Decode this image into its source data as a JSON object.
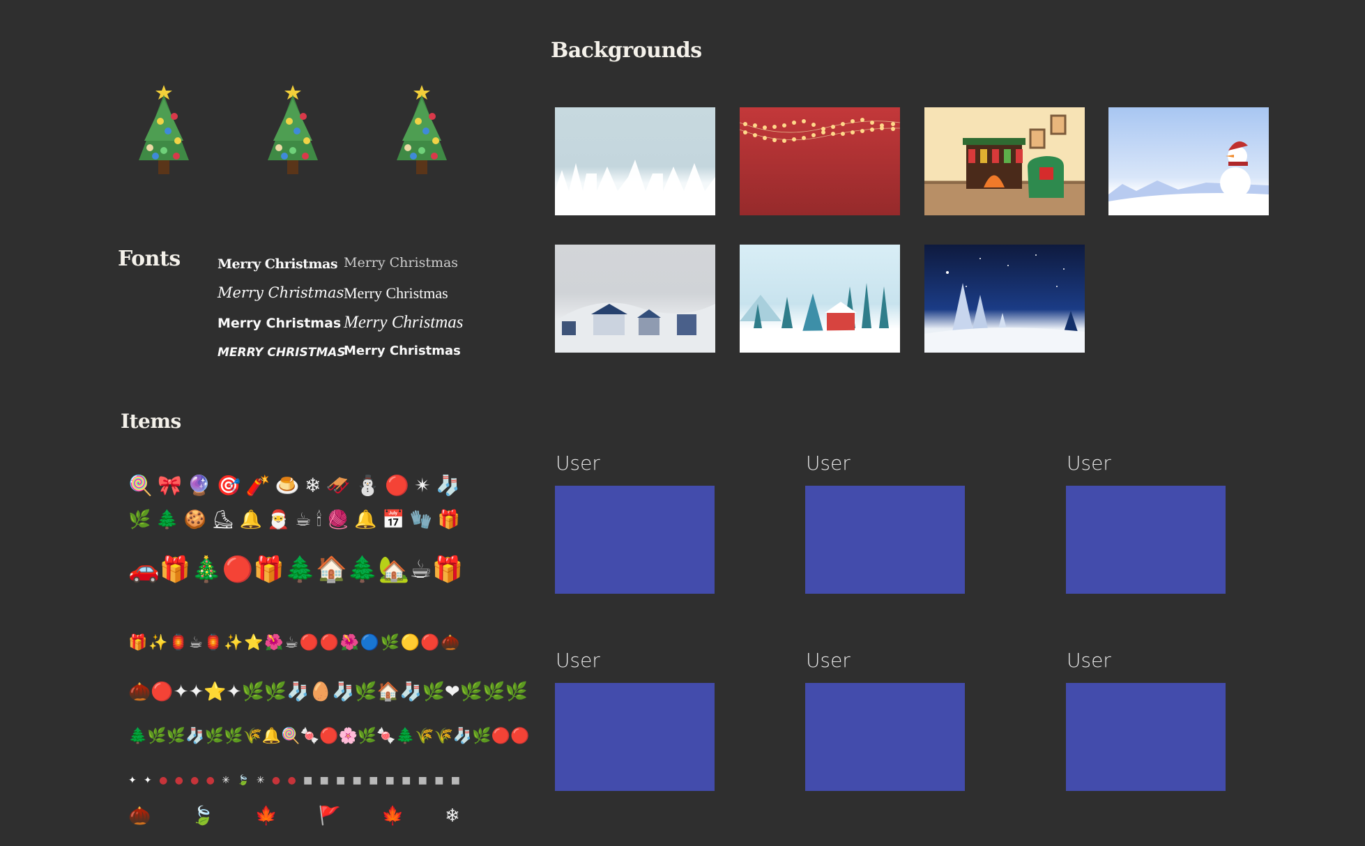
{
  "sections": {
    "backgrounds_title": "Backgrounds",
    "fonts_title": "Fonts",
    "items_title": "Items"
  },
  "trees": [
    {
      "icon": "christmas-tree-icon",
      "glyph": "🎄"
    },
    {
      "icon": "christmas-tree-icon",
      "glyph": "🎄"
    },
    {
      "icon": "christmas-tree-icon",
      "glyph": "🎄"
    }
  ],
  "fonts": {
    "samples": [
      "Merry Christmas",
      "Merry Christmas",
      "Merry Christmas",
      "Merry Christmas",
      "Merry Christmas",
      "Merry Christmas",
      "MERRY CHRISTMAS",
      "Merry Christmas"
    ]
  },
  "backgrounds": [
    {
      "name": "snowy-village"
    },
    {
      "name": "red-string-lights"
    },
    {
      "name": "fireplace-room"
    },
    {
      "name": "snowman"
    },
    {
      "name": "winter-town"
    },
    {
      "name": "red-cabin-forest"
    },
    {
      "name": "night-sky-trees"
    }
  ],
  "users": [
    {
      "label": "User",
      "color": "#434cac"
    },
    {
      "label": "User",
      "color": "#434cac"
    },
    {
      "label": "User",
      "color": "#434cac"
    },
    {
      "label": "User",
      "color": "#434cac"
    },
    {
      "label": "User",
      "color": "#434cac"
    },
    {
      "label": "User",
      "color": "#434cac"
    }
  ],
  "items": {
    "row1": [
      "🍭",
      "🎀",
      "🔮",
      "🎯",
      "🧨",
      "🍮",
      "❄",
      "🛷",
      "⛄",
      "🔴",
      "✴",
      "🧦"
    ],
    "row2": [
      "🌿",
      "🌲",
      "🍪",
      "⛸",
      "🔔",
      "🎅",
      "☕",
      "🕯",
      "🧶",
      "🔔",
      "📅",
      "🧤",
      "🎁"
    ],
    "row3": [
      "🚗",
      "🎁",
      "🎄",
      "🔴",
      "🎁",
      "🌲",
      "🏠",
      "🌲",
      "🏡",
      "☕",
      "🎁"
    ],
    "row4": [
      "🎁",
      "✨",
      "🏮",
      "☕",
      "🏮",
      "✨",
      "⭐",
      "🌺",
      "☕",
      "🔴",
      "🔴",
      "🌺",
      "🔵",
      "🌿",
      "🟡",
      "🔴",
      "🌰"
    ],
    "row5": [
      "🌰",
      "🔴",
      "✦",
      "✦",
      "⭐",
      "✦",
      "🌿",
      "🌿",
      "🧦",
      "🥚",
      "🧦",
      "🌿",
      "🏠",
      "🧦",
      "🌿",
      "❤",
      "🌿",
      "🌿",
      "🌿"
    ],
    "row6": [
      "🌲",
      "🌿",
      "🌿",
      "🧦",
      "🌿",
      "🌿",
      "🌾",
      "🔔",
      "🍭",
      "🍬",
      "🔴",
      "🌸",
      "🌿",
      "🍬",
      "🌲",
      "🌾",
      "🌾",
      "🧦",
      "🌿",
      "🔴",
      "🔴"
    ],
    "row7": [
      "✦",
      "✦",
      "●",
      "●",
      "●",
      "●",
      "✳",
      "🍃",
      "✳",
      "●",
      "●",
      "■",
      "■",
      "■",
      "■",
      "■",
      "■",
      "■",
      "■",
      "■",
      "■"
    ],
    "row8": [
      "🌰",
      "🍃",
      "🍁",
      "🚩",
      "🍁",
      "❄"
    ]
  }
}
